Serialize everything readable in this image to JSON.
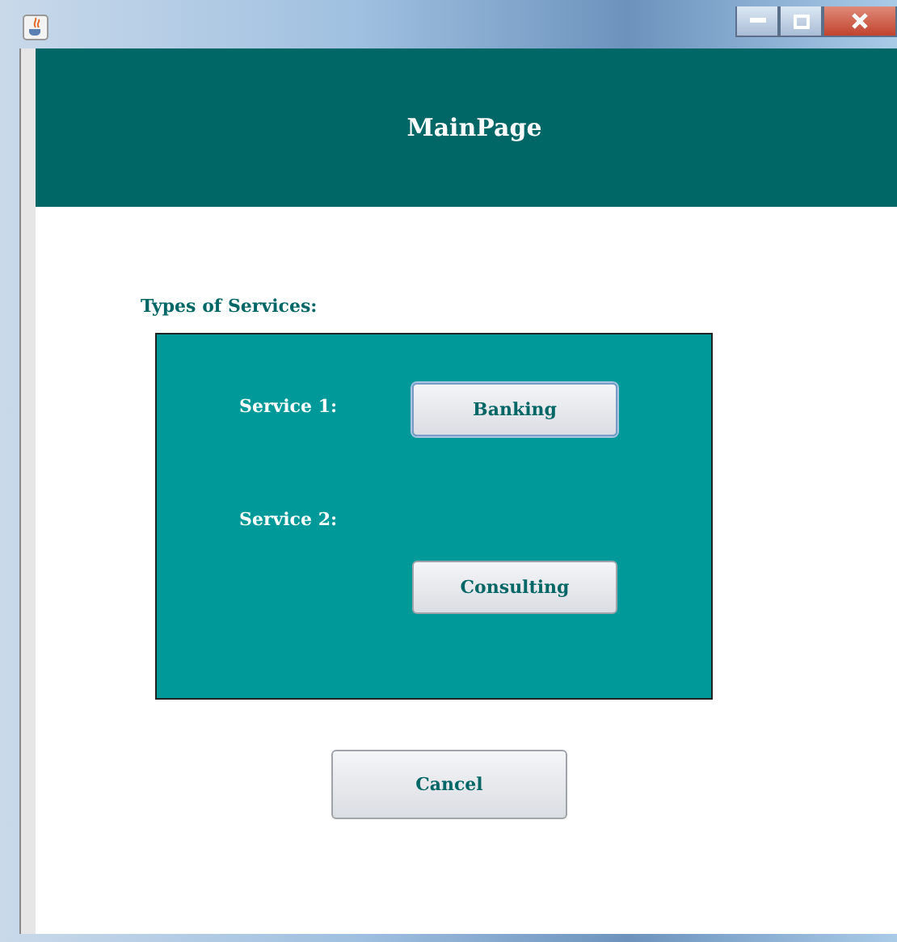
{
  "window": {
    "title": "MainPage"
  },
  "section_label": "Types of Services:",
  "services": [
    {
      "label": "Service 1:",
      "button": "Banking",
      "focused": true
    },
    {
      "label": "Service 2:",
      "button": "Consulting",
      "focused": false
    }
  ],
  "cancel_button": "Cancel"
}
